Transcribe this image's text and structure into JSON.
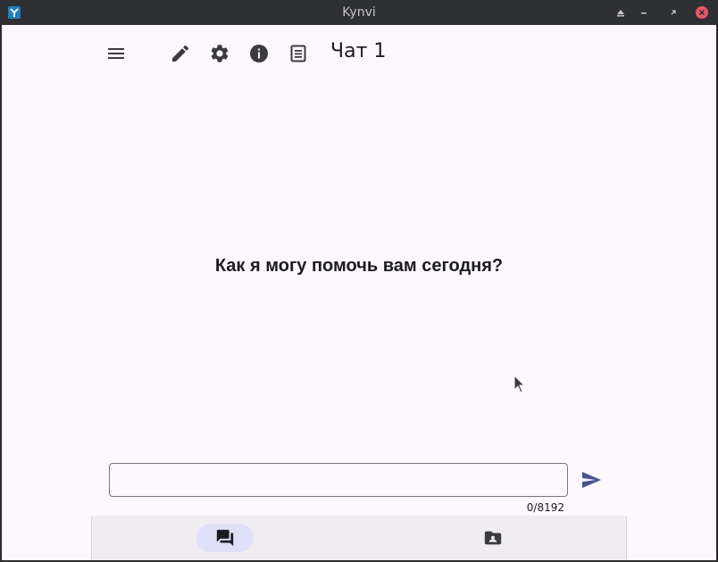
{
  "window": {
    "title": "Kynvi"
  },
  "header": {
    "chat_title": "Чат 1"
  },
  "main": {
    "greeting": "Как я могу помочь вам сегодня?"
  },
  "composer": {
    "value": "",
    "placeholder": "",
    "counter": "0/8192"
  },
  "icons": {
    "menu": "menu-icon",
    "edit": "pencil-icon",
    "settings": "gear-icon",
    "info": "info-icon",
    "notes": "document-icon",
    "send": "send-icon",
    "chats": "chat-bubbles-icon",
    "contacts": "contact-folder-icon"
  },
  "colors": {
    "accent": "#4a5190",
    "nav_active": "#e0e0f8",
    "background": "#fcf8fd",
    "titlebar": "#2f3033",
    "close": "#e8566a"
  }
}
